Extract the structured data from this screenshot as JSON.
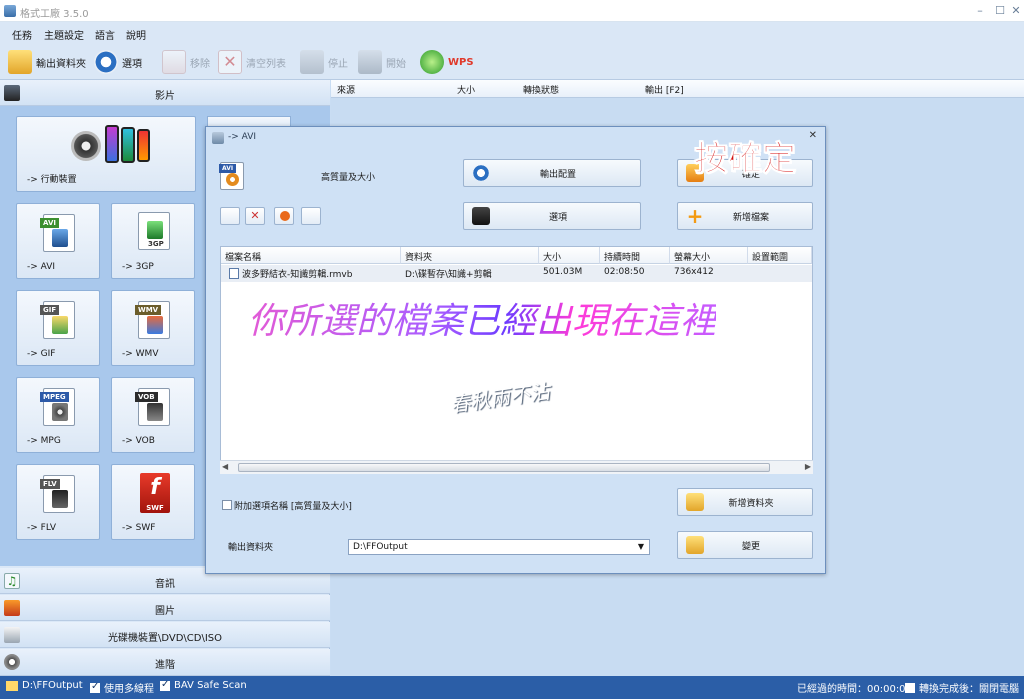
{
  "window": {
    "title": "格式工廠 3.5.0"
  },
  "menu": [
    "任務",
    "主題設定",
    "語言",
    "說明"
  ],
  "toolbar": [
    {
      "label": "輸出資料夾",
      "icon": "folder-icon",
      "enabled": true
    },
    {
      "label": "選項",
      "icon": "gear-icon",
      "enabled": true
    },
    {
      "label": "移除",
      "icon": "remove-icon",
      "enabled": false
    },
    {
      "label": "清空列表",
      "icon": "clear-list-icon",
      "enabled": false
    },
    {
      "label": "停止",
      "icon": "stop-icon",
      "enabled": false
    },
    {
      "label": "開始",
      "icon": "start-icon",
      "enabled": false
    },
    {
      "label": "WPS",
      "icon": "wps-icon",
      "enabled": true
    }
  ],
  "left_panel": {
    "video_category": "影片",
    "mobile_tile": "-> 行動裝置",
    "formats": [
      {
        "label": "-> AVI",
        "tag": "AVI"
      },
      {
        "label": "-> 3GP",
        "tag": "3GP"
      },
      {
        "label": "-> GIF",
        "tag": "GIF"
      },
      {
        "label": "-> WMV",
        "tag": "WMV"
      },
      {
        "label": "-> MPG",
        "tag": "MPEG"
      },
      {
        "label": "-> VOB",
        "tag": "VOB"
      },
      {
        "label": "-> FLV",
        "tag": "FLV"
      },
      {
        "label": "-> SWF",
        "tag": "SWF"
      }
    ],
    "categories": [
      "音訊",
      "圖片",
      "光碟機裝置\\DVD\\CD\\ISO",
      "進階"
    ]
  },
  "task_list": {
    "columns": [
      "來源",
      "大小",
      "轉換狀態",
      "輸出 [F2]"
    ]
  },
  "dialog": {
    "title": "-> AVI",
    "quality_label": "高質量及大小",
    "output_config": "輸出配置",
    "ok": "確定",
    "options": "選項",
    "add_file": "新增檔案",
    "table": {
      "columns": [
        "檔案名稱",
        "資料夾",
        "大小",
        "持續時間",
        "螢幕大小",
        "設置範圍"
      ],
      "rows": [
        {
          "name": "波多野結衣-知識剪輯.rmvb",
          "folder": "D:\\碟暫存\\知識+剪輯",
          "size": "501.03M",
          "duration": "02:08:50",
          "screen": "736x412",
          "range": ""
        }
      ]
    },
    "append_option": "附加選項名稱 [高質量及大小]",
    "add_folder": "新增資料夾",
    "output_folder_label": "輸出資料夾",
    "output_folder_value": "D:\\FFOutput",
    "change": "變更"
  },
  "overlays": {
    "press_ok": "按確定",
    "files_here": "你所選的檔案已經出現在這裡",
    "signature": "春秋兩不沾"
  },
  "status_bar": {
    "output_path": "D:\\FFOutput",
    "multithread": "使用多線程",
    "bav": "BAV Safe Scan",
    "elapsed": "已經過的時間：00:00:00",
    "after": "轉換完成後：關閉電腦"
  },
  "colors": {
    "accent_blue": "#2b5ea7",
    "annotation_red": "#d40e0e"
  }
}
